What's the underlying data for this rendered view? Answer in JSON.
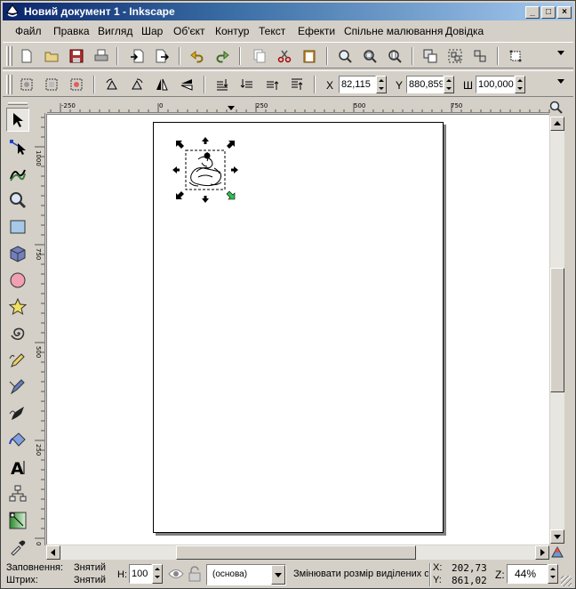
{
  "window": {
    "title": "Новий документ 1 - Inkscape"
  },
  "menu": [
    "Файл",
    "Правка",
    "Вигляд",
    "Шар",
    "Об'єкт",
    "Контур",
    "Текст",
    "Ефекти",
    "Спільне малювання",
    "Довідка"
  ],
  "coords": {
    "x_label": "X",
    "x_value": "82,115",
    "y_label": "Y",
    "y_value": "880,859",
    "w_label": "Ш",
    "w_value": "100,000"
  },
  "hruler": {
    "ticks": [
      "-250",
      "0",
      "250",
      "500",
      "750"
    ]
  },
  "vruler": {
    "ticks": [
      "1000",
      "750",
      "500",
      "250",
      "0"
    ]
  },
  "status": {
    "fill_label": "Заповнення:",
    "fill_value": "Знятий",
    "stroke_label": "Штрих:",
    "stroke_value": "Знятий",
    "opacity_label": "Н:",
    "opacity_value": "100",
    "layer_value": "(основа)",
    "message": "Змінювати розмір виділених об",
    "cursor_x_label": "X:",
    "cursor_x": "202,73",
    "cursor_y_label": "Y:",
    "cursor_y": "861,02",
    "zoom_label": "Z:",
    "zoom_value": "44%"
  },
  "colors": {
    "titlebar_start": "#0a246a",
    "titlebar_end": "#a6caf0",
    "chrome": "#d4d0c8"
  }
}
